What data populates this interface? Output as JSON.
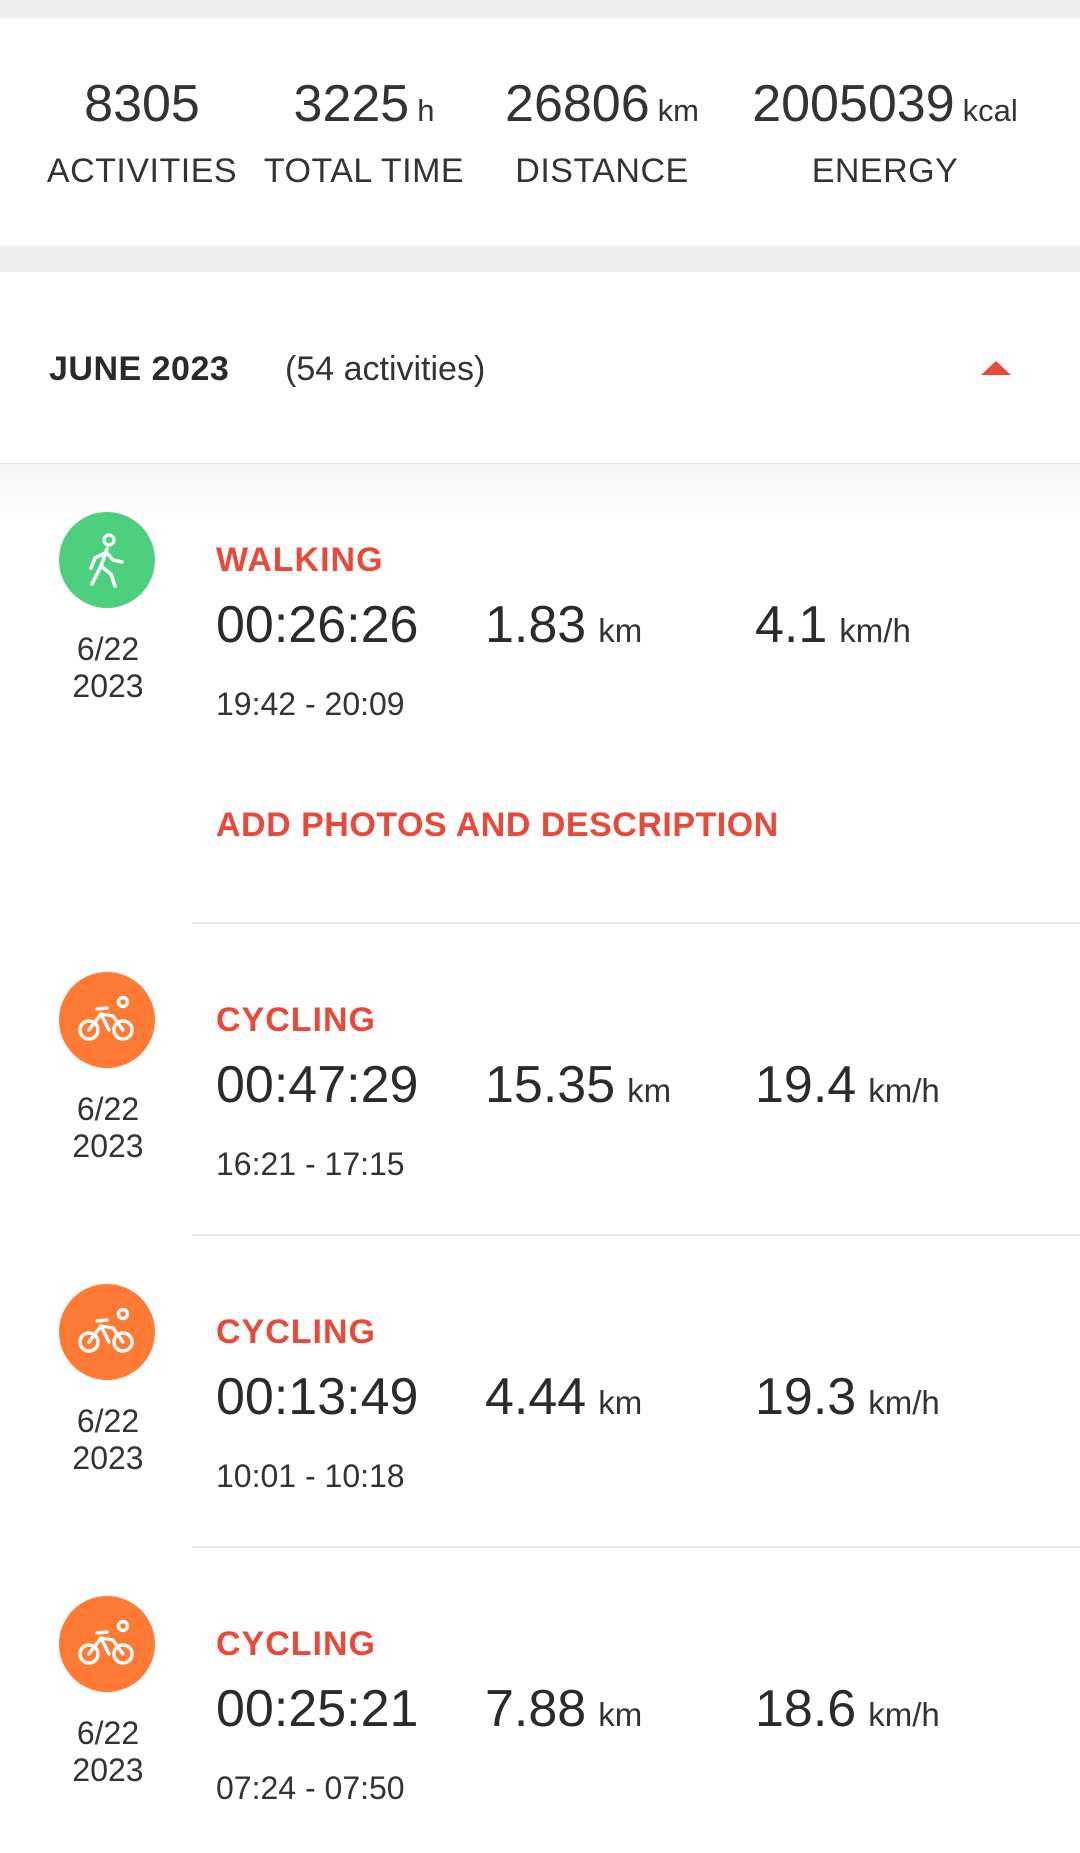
{
  "summary": {
    "activities": {
      "value": "8305",
      "label": "ACTIVITIES"
    },
    "total_time": {
      "value": "3225",
      "unit": "h",
      "label": "TOTAL TIME"
    },
    "distance": {
      "value": "26806",
      "unit": "km",
      "label": "DISTANCE"
    },
    "energy": {
      "value": "2005039",
      "unit": "kcal",
      "label": "ENERGY"
    }
  },
  "month": {
    "title": "JUNE 2023",
    "count": "(54 activities)",
    "collapse_icon": "triangle-up-icon",
    "accent_color": "#e84a3a"
  },
  "activities": [
    {
      "type": "WALKING",
      "icon": "walking-icon",
      "icon_color": "#4cd07d",
      "date_line1": "6/22",
      "date_line2": "2023",
      "duration": "00:26:26",
      "distance": "1.83",
      "distance_unit": "km",
      "speed": "4.1",
      "speed_unit": "km/h",
      "time_range": "19:42 - 20:09",
      "add_photos_label": "ADD PHOTOS AND DESCRIPTION"
    },
    {
      "type": "CYCLING",
      "icon": "cycling-icon",
      "icon_color": "#ff7a35",
      "date_line1": "6/22",
      "date_line2": "2023",
      "duration": "00:47:29",
      "distance": "15.35",
      "distance_unit": "km",
      "speed": "19.4",
      "speed_unit": "km/h",
      "time_range": "16:21 - 17:15"
    },
    {
      "type": "CYCLING",
      "icon": "cycling-icon",
      "icon_color": "#ff7a35",
      "date_line1": "6/22",
      "date_line2": "2023",
      "duration": "00:13:49",
      "distance": "4.44",
      "distance_unit": "km",
      "speed": "19.3",
      "speed_unit": "km/h",
      "time_range": "10:01 - 10:18"
    },
    {
      "type": "CYCLING",
      "icon": "cycling-icon",
      "icon_color": "#ff7a35",
      "date_line1": "6/22",
      "date_line2": "2023",
      "duration": "00:25:21",
      "distance": "7.88",
      "distance_unit": "km",
      "speed": "18.6",
      "speed_unit": "km/h",
      "time_range": "07:24 - 07:50"
    }
  ]
}
